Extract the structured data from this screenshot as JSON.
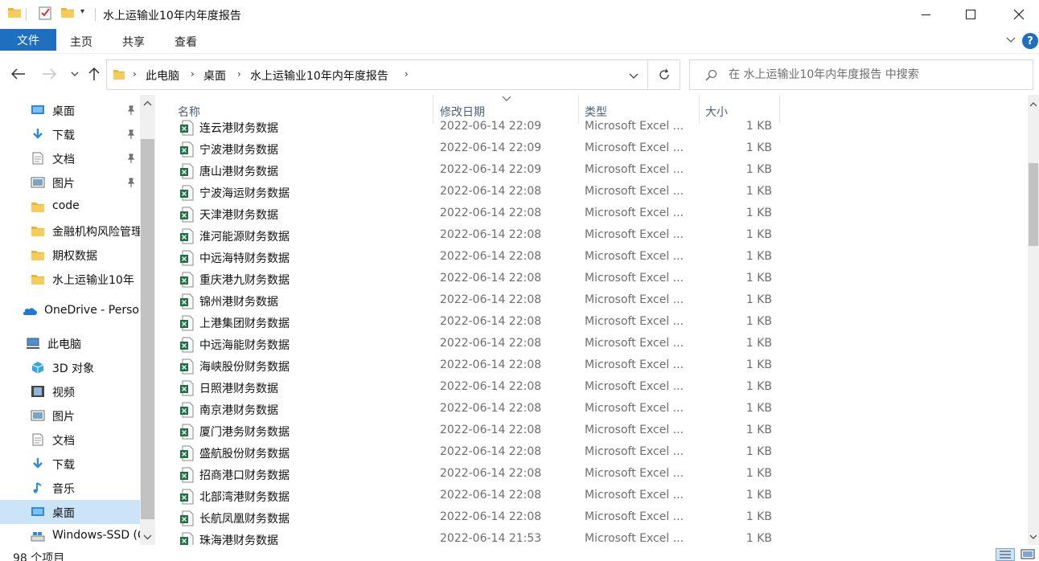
{
  "window": {
    "title": "水上运输业10年内年度报告"
  },
  "ribbon": {
    "tabs": [
      "文件",
      "主页",
      "共享",
      "查看"
    ],
    "accent": "#1f6fc1",
    "help_label": "?"
  },
  "address": {
    "crumbs": [
      "此电脑",
      "桌面",
      "水上运输业10年内年度报告"
    ]
  },
  "search": {
    "placeholder": "在 水上运输业10年内年度报告 中搜索"
  },
  "sidebar": {
    "items": [
      {
        "label": "桌面",
        "icon": "desktop-icon",
        "pinned": true
      },
      {
        "label": "下载",
        "icon": "download-icon",
        "pinned": true
      },
      {
        "label": "文档",
        "icon": "document-icon",
        "pinned": true
      },
      {
        "label": "图片",
        "icon": "pictures-icon",
        "pinned": true
      },
      {
        "label": "code",
        "icon": "folder-icon",
        "pinned": false
      },
      {
        "label": "金融机构风险管理",
        "icon": "folder-icon",
        "pinned": false
      },
      {
        "label": "期权数据",
        "icon": "folder-icon",
        "pinned": false
      },
      {
        "label": "水上运输业10年",
        "icon": "folder-icon",
        "pinned": false
      },
      {
        "label": "OneDrive - Personal",
        "icon": "onedrive-icon",
        "pinned": false
      },
      {
        "label": "此电脑",
        "icon": "this-pc-icon",
        "pinned": false
      },
      {
        "label": "3D 对象",
        "icon": "3d-objects-icon",
        "pinned": false
      },
      {
        "label": "视频",
        "icon": "video-icon",
        "pinned": false
      },
      {
        "label": "图片",
        "icon": "pictures-icon",
        "pinned": false
      },
      {
        "label": "文档",
        "icon": "document-icon",
        "pinned": false
      },
      {
        "label": "下载",
        "icon": "download-icon",
        "pinned": false
      },
      {
        "label": "音乐",
        "icon": "music-icon",
        "pinned": false
      },
      {
        "label": "桌面",
        "icon": "desktop-icon",
        "pinned": false,
        "selected": true
      },
      {
        "label": "Windows-SSD (C:)",
        "icon": "drive-icon",
        "pinned": false
      }
    ]
  },
  "columns": {
    "name": "名称",
    "date": "修改日期",
    "type": "类型",
    "size": "大小"
  },
  "files": [
    {
      "name": "连云港财务数据",
      "date": "2022-06-14 22:09",
      "type": "Microsoft Excel ...",
      "size": "1 KB"
    },
    {
      "name": "宁波港财务数据",
      "date": "2022-06-14 22:09",
      "type": "Microsoft Excel ...",
      "size": "1 KB"
    },
    {
      "name": "唐山港财务数据",
      "date": "2022-06-14 22:09",
      "type": "Microsoft Excel ...",
      "size": "1 KB"
    },
    {
      "name": "宁波海运财务数据",
      "date": "2022-06-14 22:08",
      "type": "Microsoft Excel ...",
      "size": "1 KB"
    },
    {
      "name": "天津港财务数据",
      "date": "2022-06-14 22:08",
      "type": "Microsoft Excel ...",
      "size": "1 KB"
    },
    {
      "name": "淮河能源财务数据",
      "date": "2022-06-14 22:08",
      "type": "Microsoft Excel ...",
      "size": "1 KB"
    },
    {
      "name": "中远海特财务数据",
      "date": "2022-06-14 22:08",
      "type": "Microsoft Excel ...",
      "size": "1 KB"
    },
    {
      "name": "重庆港九财务数据",
      "date": "2022-06-14 22:08",
      "type": "Microsoft Excel ...",
      "size": "1 KB"
    },
    {
      "name": "锦州港财务数据",
      "date": "2022-06-14 22:08",
      "type": "Microsoft Excel ...",
      "size": "1 KB"
    },
    {
      "name": "上港集团财务数据",
      "date": "2022-06-14 22:08",
      "type": "Microsoft Excel ...",
      "size": "1 KB"
    },
    {
      "name": "中远海能财务数据",
      "date": "2022-06-14 22:08",
      "type": "Microsoft Excel ...",
      "size": "1 KB"
    },
    {
      "name": "海峡股份财务数据",
      "date": "2022-06-14 22:08",
      "type": "Microsoft Excel ...",
      "size": "1 KB"
    },
    {
      "name": "日照港财务数据",
      "date": "2022-06-14 22:08",
      "type": "Microsoft Excel ...",
      "size": "1 KB"
    },
    {
      "name": "南京港财务数据",
      "date": "2022-06-14 22:08",
      "type": "Microsoft Excel ...",
      "size": "1 KB"
    },
    {
      "name": "厦门港务财务数据",
      "date": "2022-06-14 22:08",
      "type": "Microsoft Excel ...",
      "size": "1 KB"
    },
    {
      "name": "盛航股份财务数据",
      "date": "2022-06-14 22:08",
      "type": "Microsoft Excel ...",
      "size": "1 KB"
    },
    {
      "name": "招商港口财务数据",
      "date": "2022-06-14 22:08",
      "type": "Microsoft Excel ...",
      "size": "1 KB"
    },
    {
      "name": "北部湾港财务数据",
      "date": "2022-06-14 22:08",
      "type": "Microsoft Excel ...",
      "size": "1 KB"
    },
    {
      "name": "长航凤凰财务数据",
      "date": "2022-06-14 22:08",
      "type": "Microsoft Excel ...",
      "size": "1 KB"
    },
    {
      "name": "珠海港财务数据",
      "date": "2022-06-14 21:53",
      "type": "Microsoft Excel ...",
      "size": "1 KB"
    }
  ],
  "status": {
    "count": "98 个项目"
  }
}
